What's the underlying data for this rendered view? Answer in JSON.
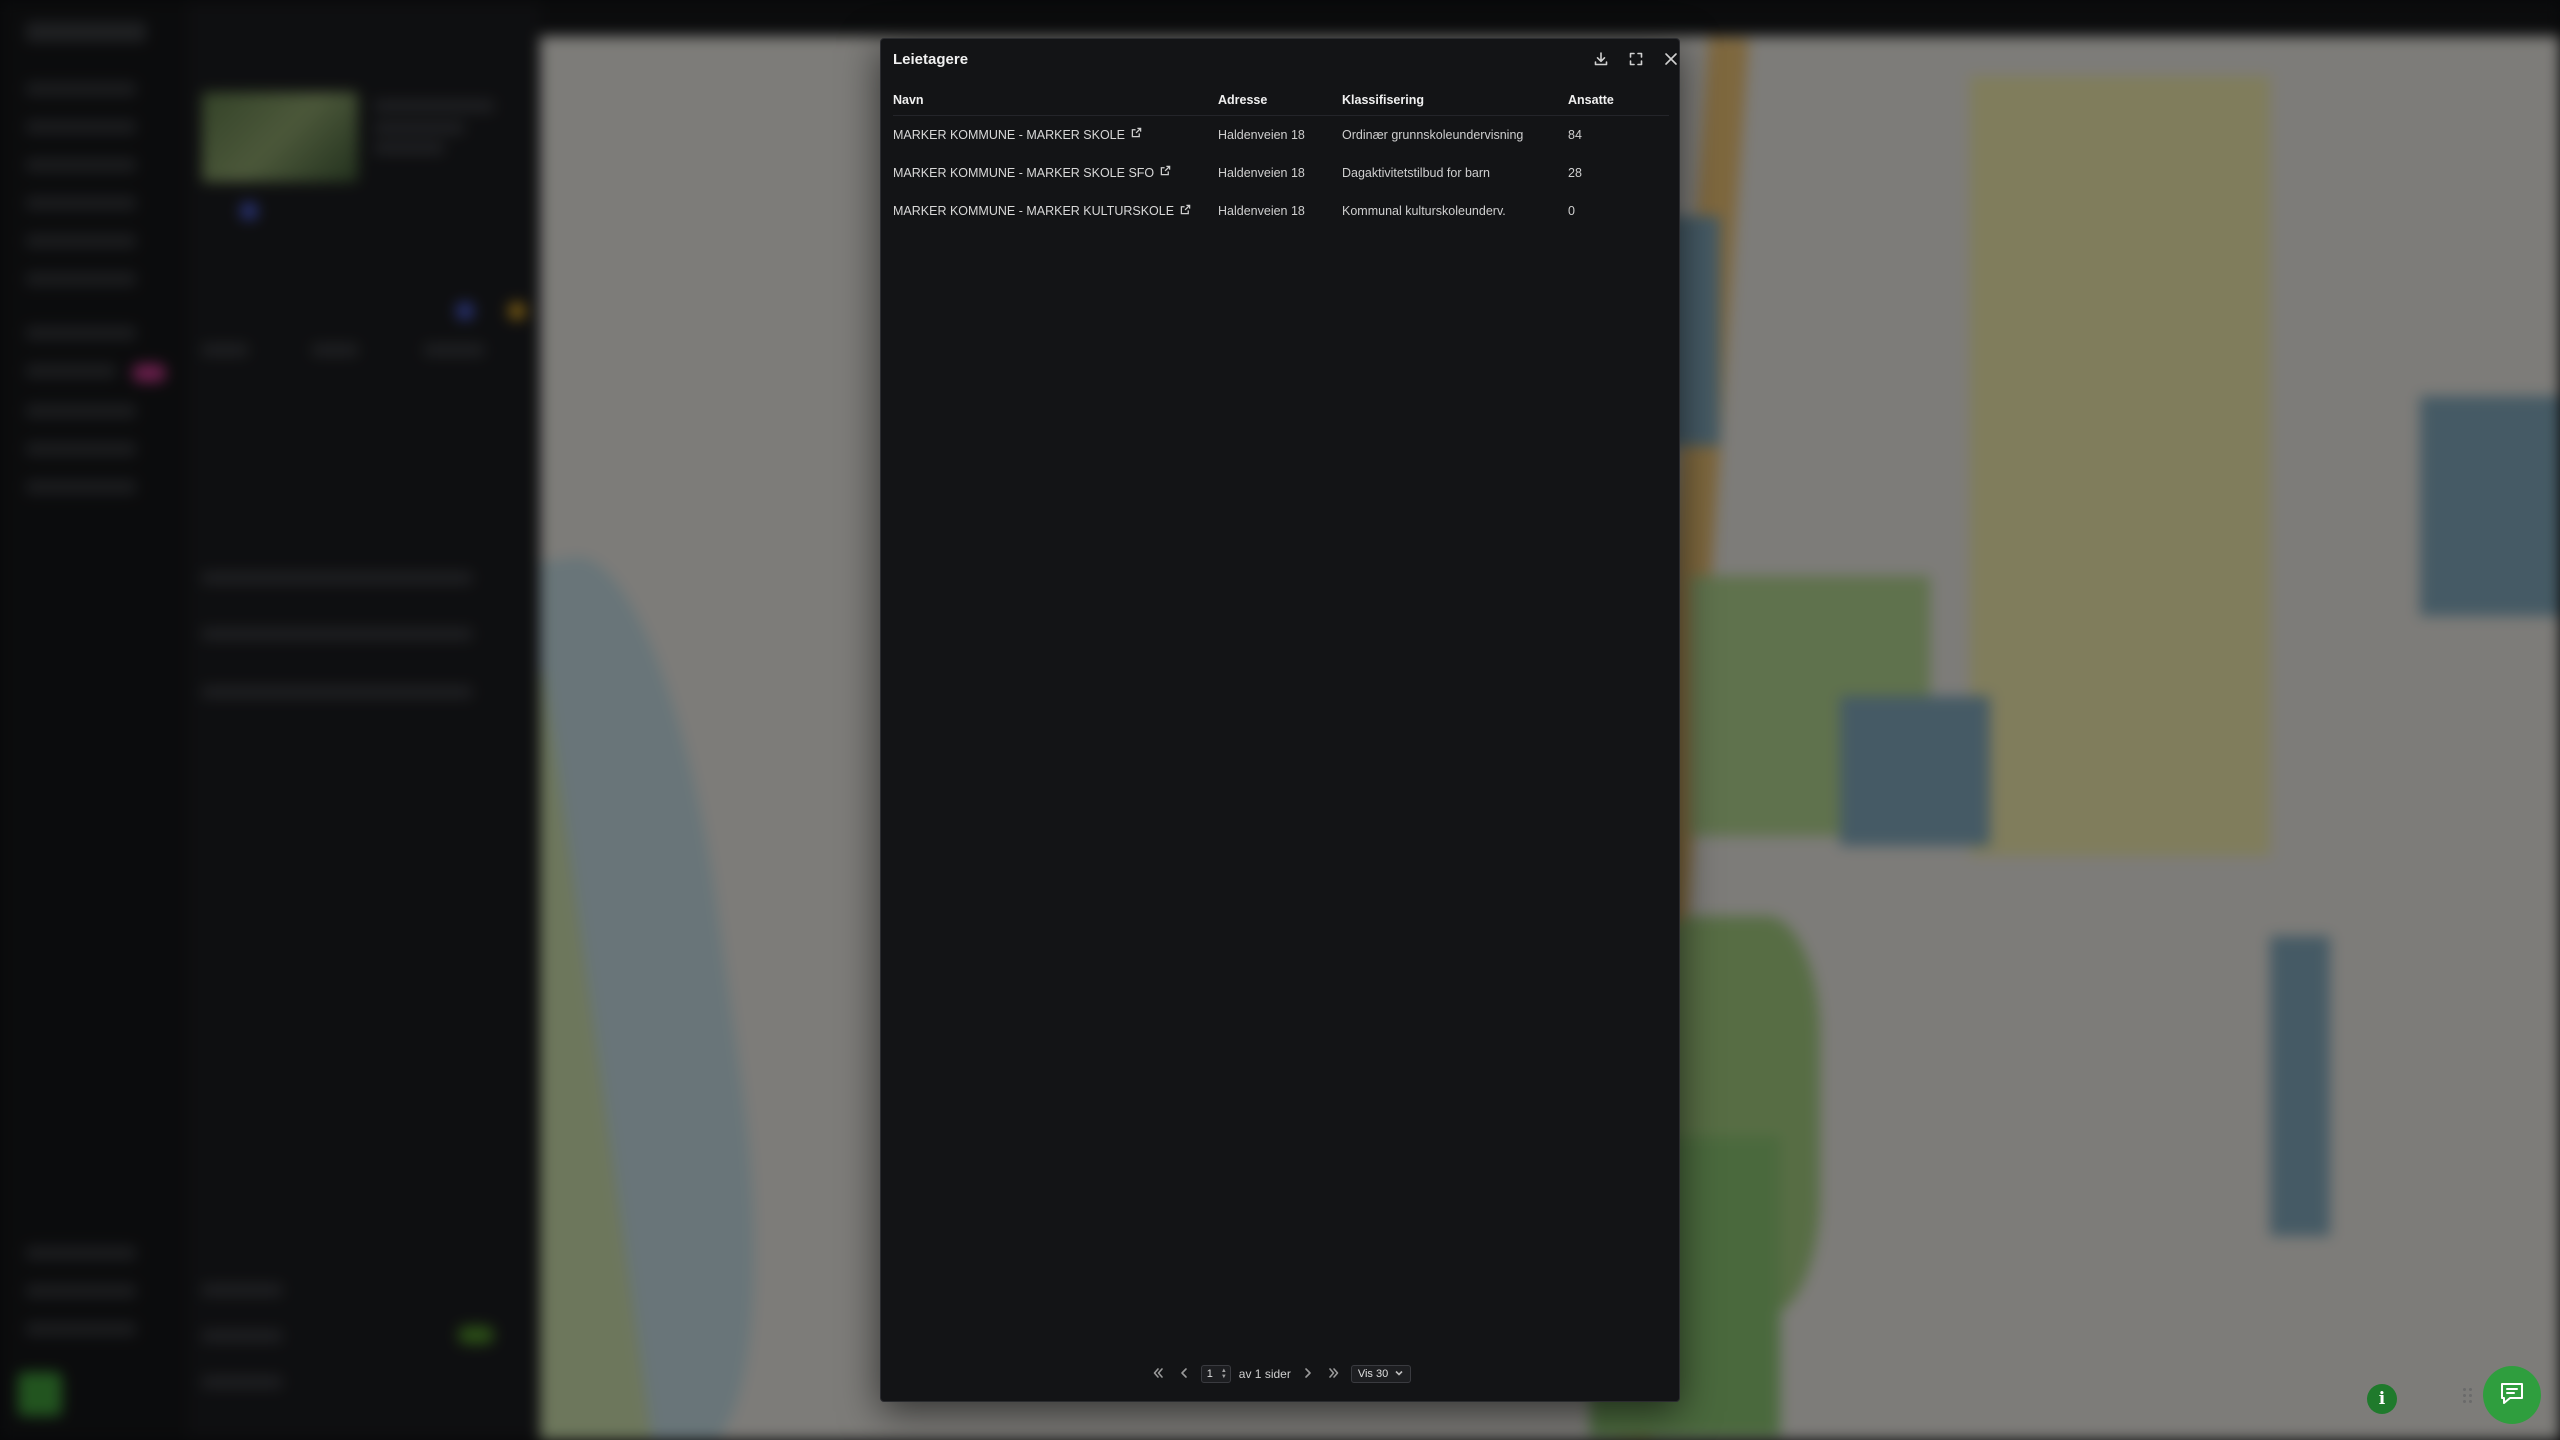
{
  "modal": {
    "title": "Leietagere",
    "columns": {
      "name": "Navn",
      "address": "Adresse",
      "classification": "Klassifisering",
      "employees": "Ansatte"
    },
    "rows": [
      {
        "name": "MARKER KOMMUNE - MARKER SKOLE",
        "address": "Haldenveien 18",
        "classification": "Ordinær grunnskoleundervisning",
        "employees": "84"
      },
      {
        "name": "MARKER KOMMUNE - MARKER SKOLE SFO",
        "address": "Haldenveien 18",
        "classification": "Dagaktivitetstilbud for barn",
        "employees": "28"
      },
      {
        "name": "MARKER KOMMUNE - MARKER KULTURSKOLE",
        "address": "Haldenveien 18",
        "classification": "Kommunal kulturskoleunderv.",
        "employees": "0"
      }
    ],
    "icons": {
      "download": "download-icon",
      "fullscreen": "fullscreen-icon",
      "close": "close-icon",
      "external": "external-link-icon"
    }
  },
  "pagination": {
    "current_page": "1",
    "of_pages": "av 1 sider",
    "page_size": "Vis 30"
  },
  "colors": {
    "modal_bg": "#131416",
    "accent_green": "#2f9e3e",
    "pink_badge": "#c0398a"
  }
}
